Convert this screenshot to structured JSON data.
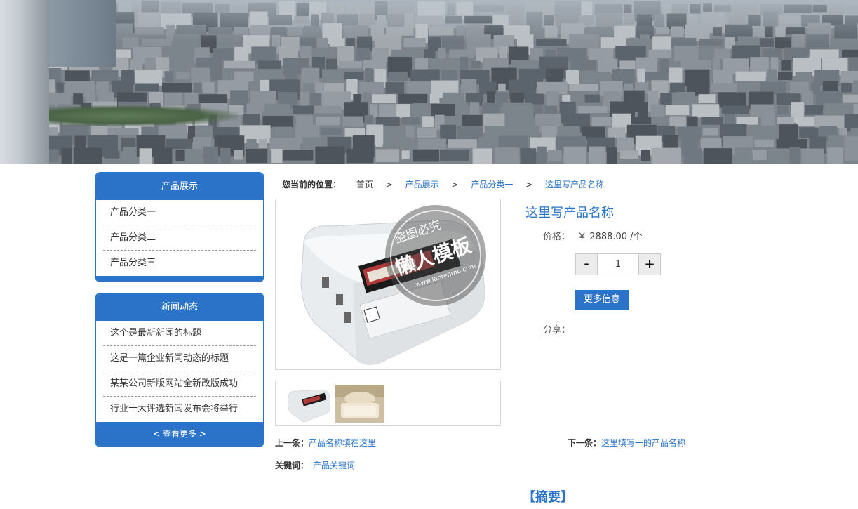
{
  "banner": {
    "alt": "city skyline"
  },
  "sidebar": {
    "products": {
      "title": "产品展示",
      "items": [
        "产品分类一",
        "产品分类二",
        "产品分类三"
      ]
    },
    "news": {
      "title": "新闻动态",
      "items": [
        "这个是最新新闻的标题",
        "这是一篇企业新闻动态的标题",
        "某某公司新版网站全新改版成功",
        "行业十大评选新闻发布会将举行"
      ],
      "more_label": "< 查看更多 >"
    }
  },
  "breadcrumb": {
    "label": "您当前的位置：",
    "sep": ">",
    "items": [
      "首页",
      "产品展示",
      "产品分类一",
      "这里写产品名称"
    ]
  },
  "watermark": {
    "line1": "盗图必究",
    "line2": "懒人模板",
    "line3": "www.lanrenmb.com"
  },
  "product": {
    "name": "这里写产品名称",
    "price_label": "价格：",
    "price": "￥ 2888.00 /个",
    "qty_minus": "-",
    "qty_plus": "+",
    "quantity": "1",
    "more_info_label": "更多信息",
    "share_label": "分享："
  },
  "nav": {
    "prev_label": "上一条：",
    "prev_title": "产品名称填在这里",
    "next_label": "下一条：",
    "next_title": "这里填写一的产品名称",
    "keywords_label": "关键词：",
    "keywords": "产品关键词"
  },
  "summary_heading": "【摘要】",
  "colors": {
    "accent": "#2a73c8",
    "border": "#d6d6d6"
  }
}
